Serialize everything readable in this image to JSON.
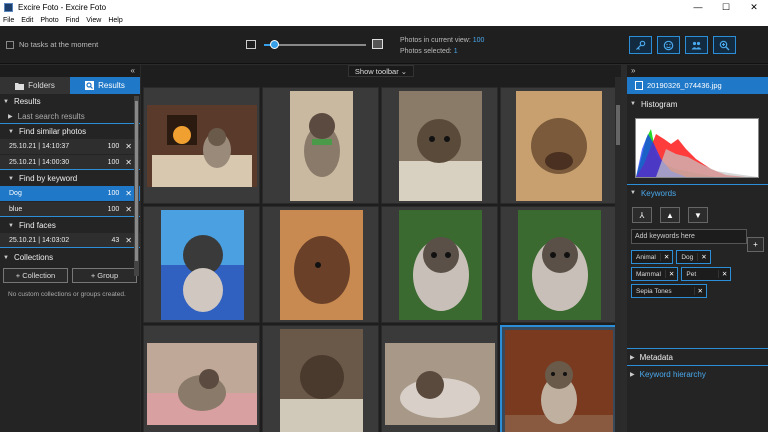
{
  "window": {
    "title": "Excire Foto - Excire Foto",
    "min": "—",
    "max": "☐",
    "close": "✕"
  },
  "menu": [
    "File",
    "Edit",
    "Photo",
    "Find",
    "View",
    "Help"
  ],
  "topbar": {
    "tasks": "No tasks at the moment",
    "photos_in_view_label": "Photos in current view:",
    "photos_in_view": "100",
    "photos_selected_label": "Photos selected:",
    "photos_selected": "1",
    "thumb_size": 0.1
  },
  "left": {
    "collapse": "«",
    "tabs": {
      "folders": "Folders",
      "results": "Results"
    },
    "results_header": "Results",
    "last_search": "Last search results",
    "find_similar": "Find similar photos",
    "similar_rows": [
      {
        "date": "25.10.21 | 14:10:37",
        "count": "100"
      },
      {
        "date": "25.10.21 | 14:00:30",
        "count": "100"
      }
    ],
    "find_keyword": "Find by keyword",
    "keyword_rows": [
      {
        "name": "Dog",
        "count": "100"
      },
      {
        "name": "blue",
        "count": "100"
      }
    ],
    "find_faces": "Find faces",
    "face_rows": [
      {
        "date": "25.10.21 | 14:03:02",
        "count": "43"
      }
    ],
    "collections": "Collections",
    "add_collection": "+ Collection",
    "add_group": "+ Group",
    "empty": "No custom collections or groups created."
  },
  "center": {
    "show_toolbar": "Show toolbar ⌄"
  },
  "right": {
    "collapse": "»",
    "filename": "20190326_074436.jpg",
    "histogram": "Histogram",
    "keywords": "Keywords",
    "add_placeholder": "Add keywords here",
    "add_btn": "+",
    "chips": [
      "Animal",
      "Dog",
      "Mammal",
      "Pet",
      "Sepia Tones"
    ],
    "metadata": "Metadata",
    "hierarchy": "Keyword hierarchy"
  },
  "colors": {
    "accent": "#2d8ed8",
    "selected": "#1f78c8",
    "panel": "#242424"
  }
}
